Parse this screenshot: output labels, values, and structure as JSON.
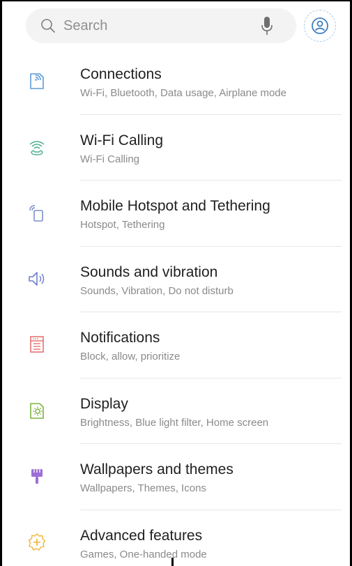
{
  "search": {
    "placeholder": "Search",
    "icon": "search-icon",
    "mic_icon": "microphone-icon",
    "account_icon": "account-icon"
  },
  "colors": {
    "connections": "#5b9bd5",
    "wifi_calling": "#4caf8f",
    "hotspot": "#7a8fc7",
    "sounds": "#6f7fd0",
    "notifications": "#e57373",
    "display": "#7cb342",
    "wallpapers": "#9c6fd6",
    "advanced": "#f2b33d"
  },
  "settings": [
    {
      "title": "Connections",
      "subtitle": "Wi-Fi, Bluetooth, Data usage, Airplane mode",
      "icon": "connections-icon"
    },
    {
      "title": "Wi-Fi Calling",
      "subtitle": "Wi-Fi Calling",
      "icon": "wifi-calling-icon"
    },
    {
      "title": "Mobile Hotspot and Tethering",
      "subtitle": "Hotspot, Tethering",
      "icon": "hotspot-icon"
    },
    {
      "title": "Sounds and vibration",
      "subtitle": "Sounds, Vibration, Do not disturb",
      "icon": "speaker-icon"
    },
    {
      "title": "Notifications",
      "subtitle": "Block, allow, prioritize",
      "icon": "notifications-icon"
    },
    {
      "title": "Display",
      "subtitle": "Brightness, Blue light filter, Home screen",
      "icon": "display-icon"
    },
    {
      "title": "Wallpapers and themes",
      "subtitle": "Wallpapers, Themes, Icons",
      "icon": "paint-brush-icon"
    },
    {
      "title": "Advanced features",
      "subtitle": "Games, One-handed mode",
      "icon": "advanced-features-icon"
    }
  ]
}
